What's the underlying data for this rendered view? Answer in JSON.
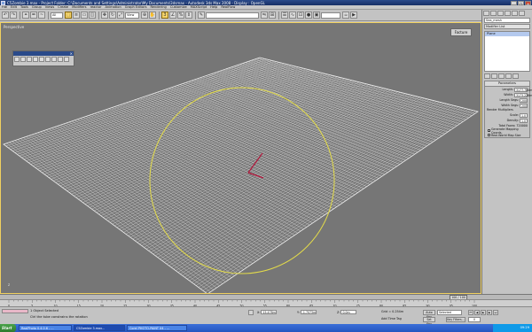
{
  "window": {
    "title": "C5Zombie 3.max - Project Folder: C:\\Documents and Settings\\Administrator\\My Documents\\3dsmax - Autodesk 3ds Max 2008 - Display : OpenGL",
    "minimize": "_",
    "maximize": "□",
    "close": "×"
  },
  "menu": [
    "File",
    "Edit",
    "Tools",
    "Group",
    "Views",
    "Create",
    "Modifiers",
    "reactor",
    "Animation",
    "Graph Editors",
    "Rendering",
    "Customize",
    "MAXScript",
    "Help",
    "RealFlow"
  ],
  "toolbar": {
    "selection_filter": "All",
    "ref_coord": "View"
  },
  "viewport": {
    "label": "Perspective",
    "floater_close": "×",
    "fracture_button": "Facture",
    "axis_label": "z"
  },
  "command_panel": {
    "object_name": "Sea_mesh",
    "modifier_list": "Modifier List",
    "stack_item": "Plane",
    "params_title": "Parameters",
    "length_label": "Length:",
    "length_value": "3177.784m",
    "width_label": "Width:",
    "width_value": "3173.228m",
    "length_segs_label": "Length Segs:",
    "length_segs_value": "200",
    "width_segs_label": "Width Segs:",
    "width_segs_value": "200",
    "render_mult_label": "Render Multipliers",
    "scale_label": "Scale:",
    "scale_value": "1.0",
    "density_label": "Density:",
    "density_value": "1.0",
    "total_faces_label": "Total Faces:",
    "total_faces_value": "720000",
    "gen_mapping_label": "Generate Mapping Coords.",
    "gen_mapping_checked": "✓",
    "real_world_label": "Real-World Map Size"
  },
  "timeline": {
    "frame_counter": "100 / 100",
    "ticks": [
      "0",
      "5",
      "10",
      "15",
      "20",
      "25",
      "30",
      "35",
      "40",
      "45",
      "50",
      "55",
      "60",
      "65",
      "70",
      "75",
      "80",
      "85",
      "90",
      "95",
      "100"
    ]
  },
  "status": {
    "selection": "1 Object Selected",
    "prompt": "Ctrl the tube constrains the rotation",
    "x_label": "X:",
    "x_value": "15.478m",
    "y_label": "Y:",
    "y_value": "-1.7073m",
    "z_label": "Z:",
    "z_value": "0.0m",
    "grid": "Grid = 0.254m",
    "add_time_tag": "Add Time Tag",
    "auto_key": "Auto Key",
    "set_key": "Set Key",
    "selected_dd": "Selected",
    "key_filters": "Key Filters...",
    "frame_value": "0"
  },
  "taskbar": {
    "start": "Start",
    "apps": [
      "RealPhoto 0.4.0.6 - ...",
      "C5Zombie 3.max...",
      "Corel PHOTO-PAINT X4 - ..."
    ],
    "clock": "09:29"
  },
  "colors": {
    "viewport_bg": "#767676",
    "mesh_wire": "#d9d9d9",
    "selection_gizmo": "#e4dc4a",
    "pivot": "#b0163a"
  }
}
